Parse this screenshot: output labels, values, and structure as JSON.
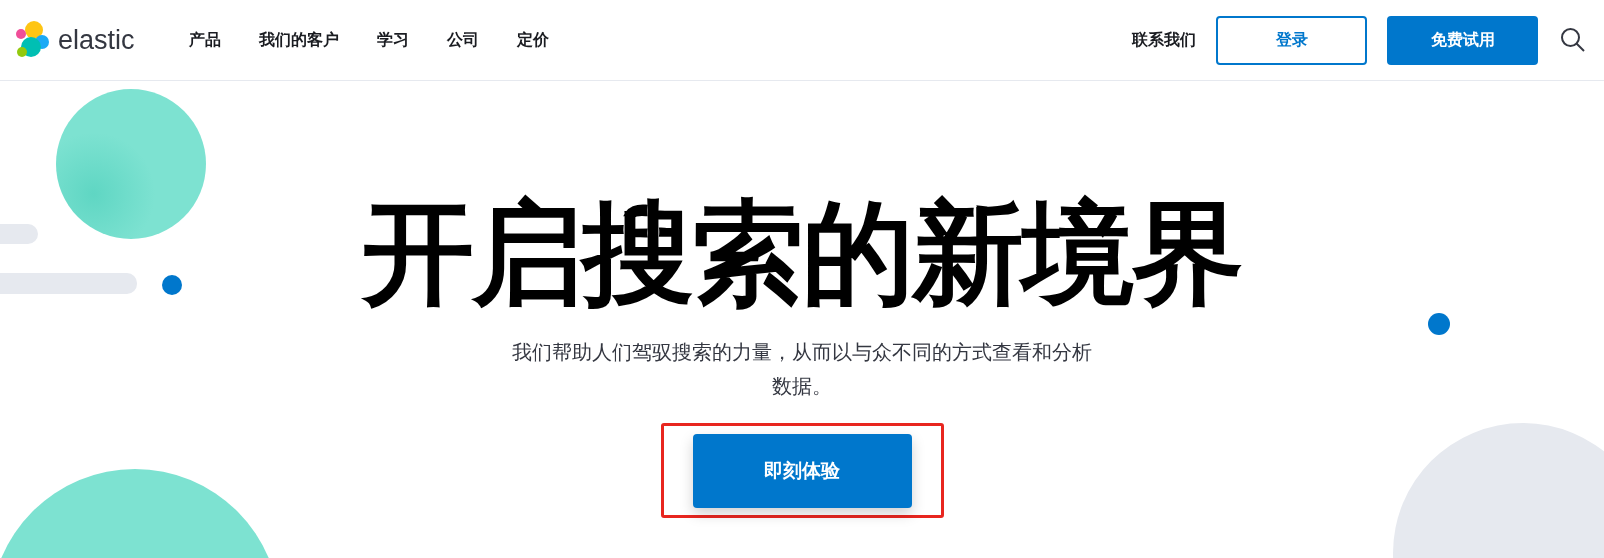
{
  "header": {
    "logo_text": "elastic",
    "nav": [
      {
        "label": "产品"
      },
      {
        "label": "我们的客户"
      },
      {
        "label": "学习"
      },
      {
        "label": "公司"
      },
      {
        "label": "定价"
      }
    ],
    "contact": "联系我们",
    "login": "登录",
    "trial": "免费试用"
  },
  "hero": {
    "title": "开启搜索的新境界",
    "subtitle": "我们帮助人们驾驭搜索的力量，从而以与众不同的方式查看和分析数据。",
    "cta": "即刻体验"
  }
}
